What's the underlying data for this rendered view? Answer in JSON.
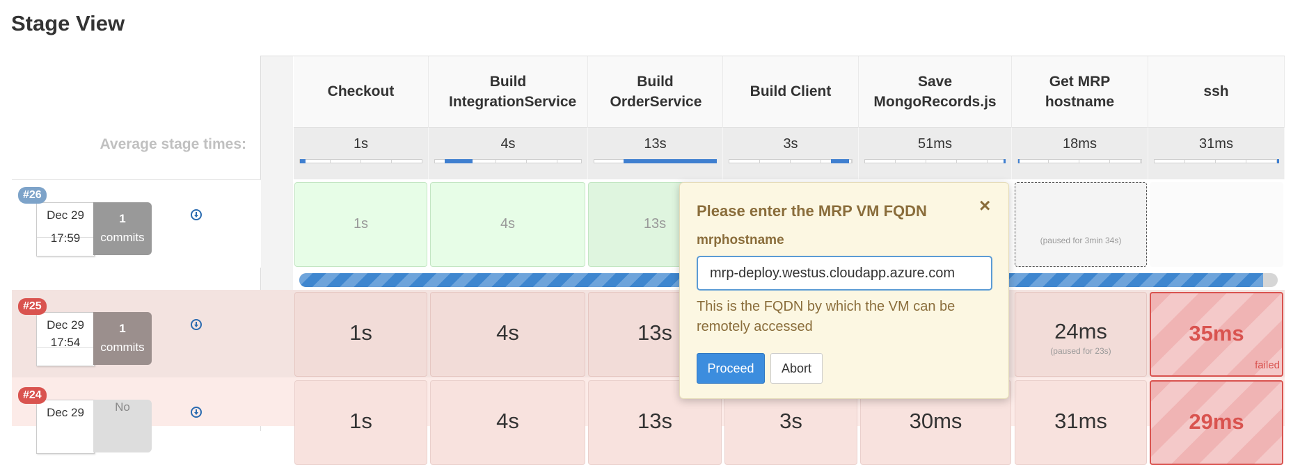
{
  "page_title": "Stage View",
  "average_label": "Average stage times:",
  "stages": [
    {
      "name": "Checkout",
      "avg": "1s",
      "avg_fraction": 0.02
    },
    {
      "name": "Build IntegrationService",
      "avg": "4s",
      "avg_fraction": 0.06
    },
    {
      "name": "Build OrderService",
      "avg": "13s",
      "avg_fraction": 0.19
    },
    {
      "name": "Build Client",
      "avg": "3s",
      "avg_fraction": 0.04
    },
    {
      "name": "Save MongoRecords.js",
      "avg": "51ms",
      "avg_fraction": 0.01
    },
    {
      "name": "Get MRP hostname",
      "avg": "18ms",
      "avg_fraction": 0.01
    },
    {
      "name": "ssh",
      "avg": "31ms",
      "avg_fraction": 0.01
    }
  ],
  "runs": [
    {
      "id": "#26",
      "date": "Dec 29",
      "time": "17:59",
      "commits_count": "1",
      "commits_label": "commits",
      "cells": [
        "1s",
        "4s",
        "13s",
        "",
        "",
        "(paused for 3min 34s)",
        ""
      ]
    },
    {
      "id": "#25",
      "date": "Dec 29",
      "time": "17:54",
      "commits_count": "1",
      "commits_label": "commits",
      "cells": [
        "1s",
        "4s",
        "13s",
        "",
        "",
        "24ms",
        "35ms"
      ],
      "paused_note": "(paused for 23s)",
      "status": "failed"
    },
    {
      "id": "#24",
      "date": "Dec 29",
      "commits_label": "No",
      "cells": [
        "1s",
        "4s",
        "13s",
        "3s",
        "30ms",
        "31ms",
        "29ms"
      ]
    }
  ],
  "run26_progress": 0.985,
  "colors": {
    "success": "#dff5df",
    "failed_bg": "#f2dcd8",
    "failed_accent": "#d9534f",
    "accent": "#3c8dde",
    "badge_blue": "#7da3c9",
    "badge_red": "#d9534f"
  },
  "popover": {
    "title": "Please enter the MRP VM FQDN",
    "close_icon": "×",
    "param_label": "mrphostname",
    "param_value": "mrp-deploy.westus.cloudapp.azure.com",
    "help": "This is the FQDN by which the VM can be remotely accessed",
    "proceed": "Proceed",
    "abort": "Abort"
  }
}
